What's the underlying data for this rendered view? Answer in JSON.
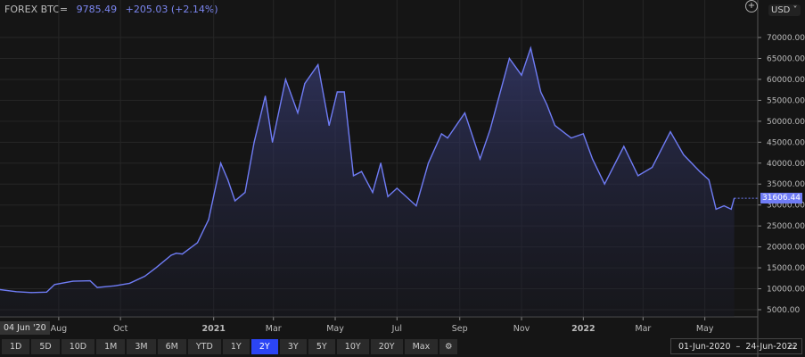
{
  "header": {
    "symbol": "FOREX BTC=",
    "price": "9785.49",
    "change": "+205.03 (+2.14%)"
  },
  "currency": "USD",
  "cursor_date_label": "04 Jun '20",
  "last_price_label": "31606.44",
  "range_buttons": [
    "1D",
    "5D",
    "10D",
    "1M",
    "3M",
    "6M",
    "YTD",
    "1Y",
    "2Y",
    "3Y",
    "5Y",
    "10Y",
    "20Y",
    "Max"
  ],
  "active_range": "2Y",
  "date_range": {
    "from": "01-Jun-2020",
    "sep": "–",
    "to": "24-Jun-2022"
  },
  "colors": {
    "line": "#6f7cf5",
    "active": "#2b45f5",
    "background": "#151515"
  },
  "icons": [
    "zoom-plus-icon",
    "settings-gear-icon",
    "calendar-icon"
  ],
  "chart_data": {
    "type": "area",
    "ylim": [
      2000,
      72000
    ],
    "yticks": [
      5000,
      10000,
      15000,
      20000,
      25000,
      30000,
      35000,
      40000,
      45000,
      50000,
      55000,
      60000,
      65000,
      70000
    ],
    "ytick_labels": [
      "5000.00",
      "10000.00",
      "15000.00",
      "20000.00",
      "25000.00",
      "30000.00",
      "35000.00",
      "40000.00",
      "45000.00",
      "50000.00",
      "55000.00",
      "60000.00",
      "65000.00",
      "70000.00"
    ],
    "xlim": [
      "2020-06-04",
      "2022-06-24"
    ],
    "xticks": [
      {
        "date": "2020-08-01",
        "label": "Aug"
      },
      {
        "date": "2020-10-01",
        "label": "Oct"
      },
      {
        "date": "2021-01-01",
        "label": "2021"
      },
      {
        "date": "2021-03-01",
        "label": "Mar"
      },
      {
        "date": "2021-05-01",
        "label": "May"
      },
      {
        "date": "2021-07-01",
        "label": "Jul"
      },
      {
        "date": "2021-09-01",
        "label": "Sep"
      },
      {
        "date": "2021-11-01",
        "label": "Nov"
      },
      {
        "date": "2022-01-01",
        "label": "2022"
      },
      {
        "date": "2022-03-01",
        "label": "Mar"
      },
      {
        "date": "2022-05-01",
        "label": "May"
      }
    ],
    "grid": true,
    "points": [
      [
        "2020-06-04",
        9800
      ],
      [
        "2020-06-20",
        9300
      ],
      [
        "2020-07-05",
        9100
      ],
      [
        "2020-07-20",
        9200
      ],
      [
        "2020-07-28",
        11000
      ],
      [
        "2020-08-15",
        11800
      ],
      [
        "2020-09-01",
        11900
      ],
      [
        "2020-09-08",
        10300
      ],
      [
        "2020-09-25",
        10700
      ],
      [
        "2020-10-10",
        11300
      ],
      [
        "2020-10-25",
        13000
      ],
      [
        "2020-11-05",
        15000
      ],
      [
        "2020-11-20",
        18000
      ],
      [
        "2020-11-25",
        18500
      ],
      [
        "2020-12-01",
        18300
      ],
      [
        "2020-12-16",
        21000
      ],
      [
        "2020-12-27",
        26500
      ],
      [
        "2021-01-08",
        40000
      ],
      [
        "2021-01-15",
        36000
      ],
      [
        "2021-01-22",
        31000
      ],
      [
        "2021-02-01",
        33000
      ],
      [
        "2021-02-10",
        45000
      ],
      [
        "2021-02-21",
        56000
      ],
      [
        "2021-02-28",
        45000
      ],
      [
        "2021-03-13",
        60000
      ],
      [
        "2021-03-25",
        52000
      ],
      [
        "2021-04-01",
        59000
      ],
      [
        "2021-04-14",
        63500
      ],
      [
        "2021-04-25",
        49000
      ],
      [
        "2021-05-03",
        57000
      ],
      [
        "2021-05-10",
        57000
      ],
      [
        "2021-05-19",
        37000
      ],
      [
        "2021-05-27",
        38000
      ],
      [
        "2021-06-07",
        33000
      ],
      [
        "2021-06-15",
        40000
      ],
      [
        "2021-06-22",
        32000
      ],
      [
        "2021-07-01",
        34000
      ],
      [
        "2021-07-20",
        29800
      ],
      [
        "2021-08-01",
        40000
      ],
      [
        "2021-08-14",
        47000
      ],
      [
        "2021-08-20",
        46000
      ],
      [
        "2021-09-06",
        52000
      ],
      [
        "2021-09-21",
        41000
      ],
      [
        "2021-10-01",
        48000
      ],
      [
        "2021-10-20",
        65000
      ],
      [
        "2021-11-01",
        61000
      ],
      [
        "2021-11-10",
        67500
      ],
      [
        "2021-11-20",
        57000
      ],
      [
        "2021-11-26",
        54000
      ],
      [
        "2021-12-04",
        49000
      ],
      [
        "2021-12-20",
        46000
      ],
      [
        "2022-01-01",
        47000
      ],
      [
        "2022-01-10",
        41000
      ],
      [
        "2022-01-22",
        35000
      ],
      [
        "2022-02-10",
        44000
      ],
      [
        "2022-02-24",
        37000
      ],
      [
        "2022-03-10",
        39000
      ],
      [
        "2022-03-28",
        47500
      ],
      [
        "2022-04-10",
        42000
      ],
      [
        "2022-04-26",
        38000
      ],
      [
        "2022-05-05",
        36000
      ],
      [
        "2022-05-12",
        29000
      ],
      [
        "2022-05-20",
        29800
      ],
      [
        "2022-05-27",
        29000
      ],
      [
        "2022-05-30",
        31606.44
      ]
    ]
  }
}
